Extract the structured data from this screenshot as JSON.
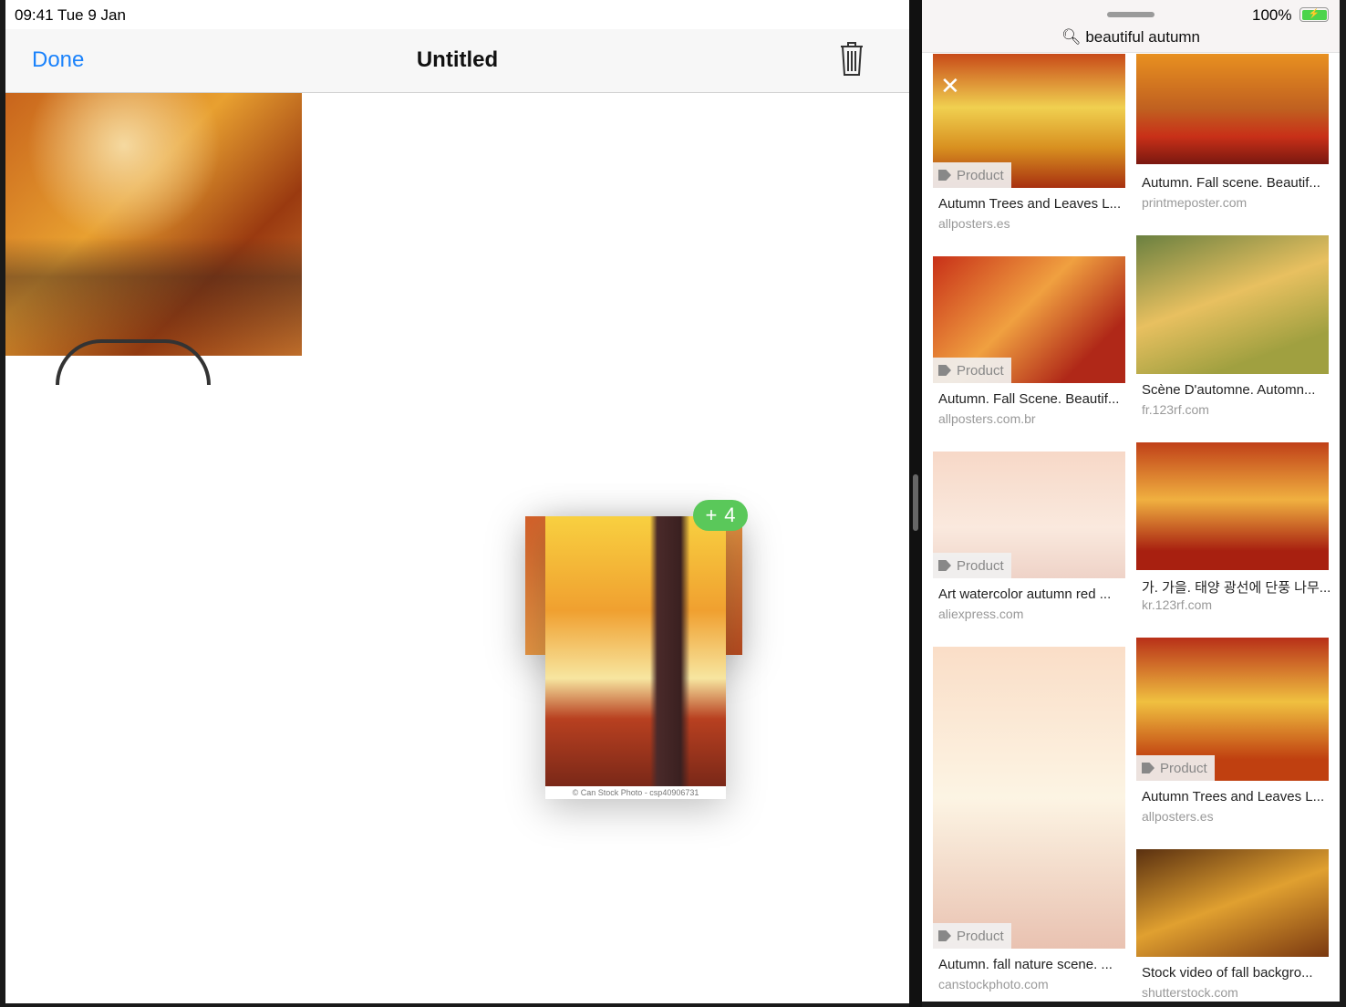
{
  "status": {
    "time": "09:41  Tue 9 Jan",
    "battery": "100%"
  },
  "navbar": {
    "done": "Done",
    "title": "Untitled"
  },
  "drag": {
    "caption": "© Can Stock Photo - csp40906731",
    "badge_plus": "+",
    "badge_count": "4"
  },
  "search": {
    "query": "beautiful autumn"
  },
  "tag_label": "Product",
  "results": [
    {
      "title": "Autumn Trees and Leaves L...",
      "source": "allposters.es",
      "product": true
    },
    {
      "title": "Autumn. Fall scene. Beautif...",
      "source": "printmeposter.com",
      "product": false
    },
    {
      "title": "Autumn. Fall Scene. Beautif...",
      "source": "allposters.com.br",
      "product": true
    },
    {
      "title": "Scène D'automne. Automn...",
      "source": "fr.123rf.com",
      "product": false
    },
    {
      "title": "Art watercolor autumn red ...",
      "source": "aliexpress.com",
      "product": true
    },
    {
      "title": "가. 가을. 태양 광선에 단풍 나무...",
      "source": "kr.123rf.com",
      "product": false
    },
    {
      "title": "Autumn. fall nature scene. ...",
      "source": "canstockphoto.com",
      "product": true
    },
    {
      "title": "Autumn Trees and Leaves L...",
      "source": "allposters.es",
      "product": true
    },
    {
      "title": "Stock video of fall backgro...",
      "source": "shutterstock.com",
      "product": false
    }
  ]
}
